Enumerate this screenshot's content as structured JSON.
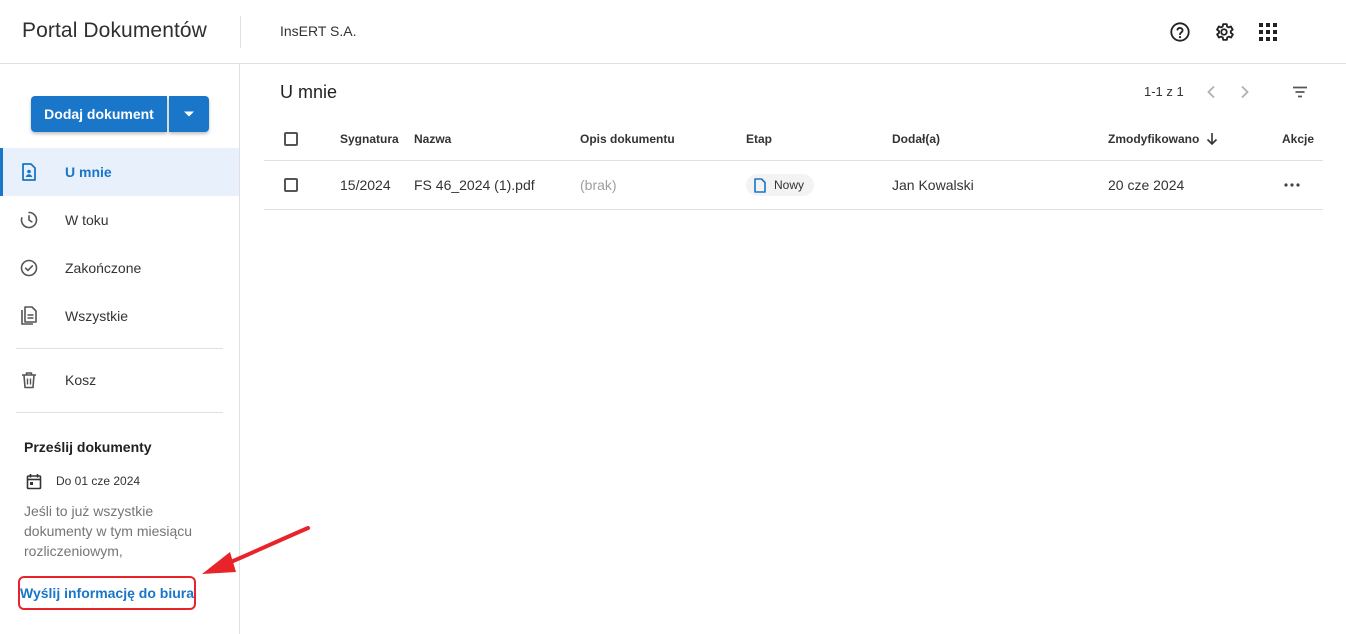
{
  "header": {
    "app_title": "Portal Dokumentów",
    "company": "InsERT S.A.",
    "icons": [
      "help-icon",
      "gear-icon",
      "apps-grid-icon"
    ]
  },
  "sidebar": {
    "add_button_label": "Dodaj dokument",
    "items": [
      {
        "label": "U mnie",
        "icon": "person-document-icon",
        "active": true
      },
      {
        "label": "W toku",
        "icon": "clock-icon",
        "active": false
      },
      {
        "label": "Zakończone",
        "icon": "check-circle-icon",
        "active": false
      },
      {
        "label": "Wszystkie",
        "icon": "documents-icon",
        "active": false
      },
      {
        "label": "Kosz",
        "icon": "trash-icon",
        "active": false
      }
    ],
    "send_section": {
      "title": "Prześlij dokumenty",
      "deadline": "Do 01 cze 2024",
      "text": "Jeśli to już wszystkie dokumenty w tym miesiącu rozliczeniowym,",
      "link_label": "Wyślij informację do biura"
    }
  },
  "main": {
    "title": "U mnie",
    "pagination": "1-1 z 1",
    "columns": {
      "signature": "Sygnatura",
      "name": "Nazwa",
      "description": "Opis dokumentu",
      "stage": "Etap",
      "added_by": "Dodał(a)",
      "modified": "Zmodyfikowano",
      "actions": "Akcje"
    },
    "rows": [
      {
        "signature": "15/2024",
        "name": "FS 46_2024 (1).pdf",
        "description": "(brak)",
        "stage": "Nowy",
        "added_by": "Jan Kowalski",
        "modified": "20 cze 2024"
      }
    ]
  },
  "colors": {
    "accent": "#1976c8",
    "active_bg": "#e8f1fb",
    "annotation": "#e8242a"
  }
}
